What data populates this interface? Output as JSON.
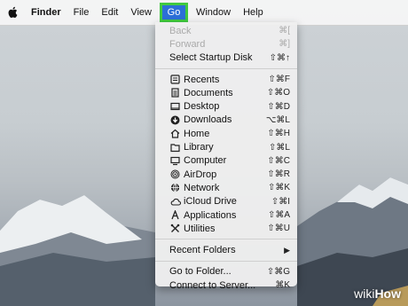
{
  "menubar": {
    "app": "Finder",
    "items": [
      "File",
      "Edit",
      "View"
    ],
    "active": "Go",
    "after": [
      "Window",
      "Help"
    ]
  },
  "menu": {
    "nav": [
      {
        "label": "Back",
        "shortcut": "⌘[",
        "disabled": true
      },
      {
        "label": "Forward",
        "shortcut": "⌘]",
        "disabled": true
      },
      {
        "label": "Select Startup Disk",
        "shortcut": "⇧⌘↑",
        "disabled": false
      }
    ],
    "places": [
      {
        "label": "Recents",
        "shortcut": "⇧⌘F",
        "icon": "recents-icon"
      },
      {
        "label": "Documents",
        "shortcut": "⇧⌘O",
        "icon": "documents-icon"
      },
      {
        "label": "Desktop",
        "shortcut": "⇧⌘D",
        "icon": "desktop-icon"
      },
      {
        "label": "Downloads",
        "shortcut": "⌥⌘L",
        "icon": "downloads-icon"
      },
      {
        "label": "Home",
        "shortcut": "⇧⌘H",
        "icon": "home-icon"
      },
      {
        "label": "Library",
        "shortcut": "⇧⌘L",
        "icon": "library-icon"
      },
      {
        "label": "Computer",
        "shortcut": "⇧⌘C",
        "icon": "computer-icon"
      },
      {
        "label": "AirDrop",
        "shortcut": "⇧⌘R",
        "icon": "airdrop-icon"
      },
      {
        "label": "Network",
        "shortcut": "⇧⌘K",
        "icon": "network-icon"
      },
      {
        "label": "iCloud Drive",
        "shortcut": "⇧⌘I",
        "icon": "icloud-icon"
      },
      {
        "label": "Applications",
        "shortcut": "⇧⌘A",
        "icon": "applications-icon"
      },
      {
        "label": "Utilities",
        "shortcut": "⇧⌘U",
        "icon": "utilities-icon"
      }
    ],
    "recent_folders": "Recent Folders",
    "goto": [
      {
        "label": "Go to Folder...",
        "shortcut": "⇧⌘G"
      },
      {
        "label": "Connect to Server...",
        "shortcut": "⌘K"
      }
    ]
  },
  "colors": {
    "highlight": "#2c6fd8",
    "outline": "#40c940"
  },
  "watermark": {
    "wiki": "wiki",
    "how": "How"
  }
}
